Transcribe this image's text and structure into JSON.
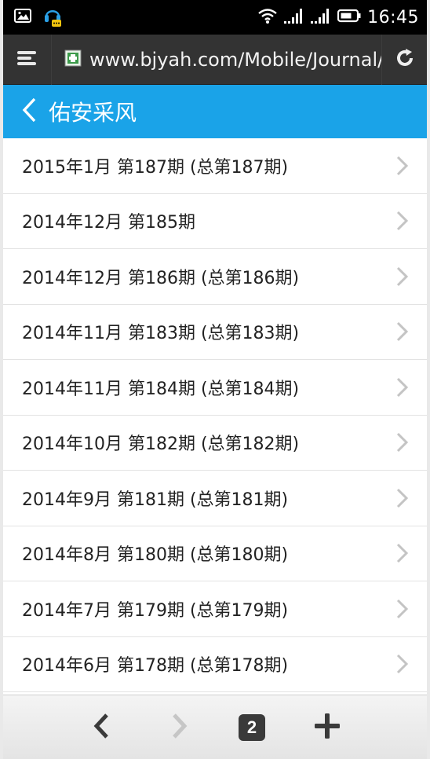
{
  "statusbar": {
    "time": "16:45",
    "icons": [
      "image-icon",
      "headset-icon",
      "wifi-icon",
      "signal-icon",
      "signal-icon",
      "battery-icon"
    ]
  },
  "browser": {
    "url": "www.bjyah.com/Mobile/Journal/In",
    "menu_icon": "menu-icon",
    "reload_icon": "reload-icon",
    "favicon": "favicon-icon"
  },
  "titlebar": {
    "title": "佑安采风",
    "back_icon": "chevron-left-icon"
  },
  "list": {
    "items": [
      {
        "label": "2015年1月 第187期 (总第187期)"
      },
      {
        "label": "2014年12月 第185期"
      },
      {
        "label": "2014年12月 第186期 (总第186期)"
      },
      {
        "label": "2014年11月 第183期 (总第183期)"
      },
      {
        "label": "2014年11月 第184期 (总第184期)"
      },
      {
        "label": "2014年10月 第182期 (总第182期)"
      },
      {
        "label": "2014年9月 第181期 (总第181期)"
      },
      {
        "label": "2014年8月 第180期 (总第180期)"
      },
      {
        "label": "2014年7月 第179期 (总第179期)"
      },
      {
        "label": "2014年6月 第178期 (总第178期)"
      }
    ]
  },
  "bottombar": {
    "tab_count": "2",
    "back_icon": "chevron-left-icon",
    "forward_icon": "chevron-right-icon",
    "new_tab_icon": "plus-icon"
  },
  "colors": {
    "accent": "#1aa3e8",
    "browser_bar": "#333333",
    "status_bar": "#000000"
  }
}
